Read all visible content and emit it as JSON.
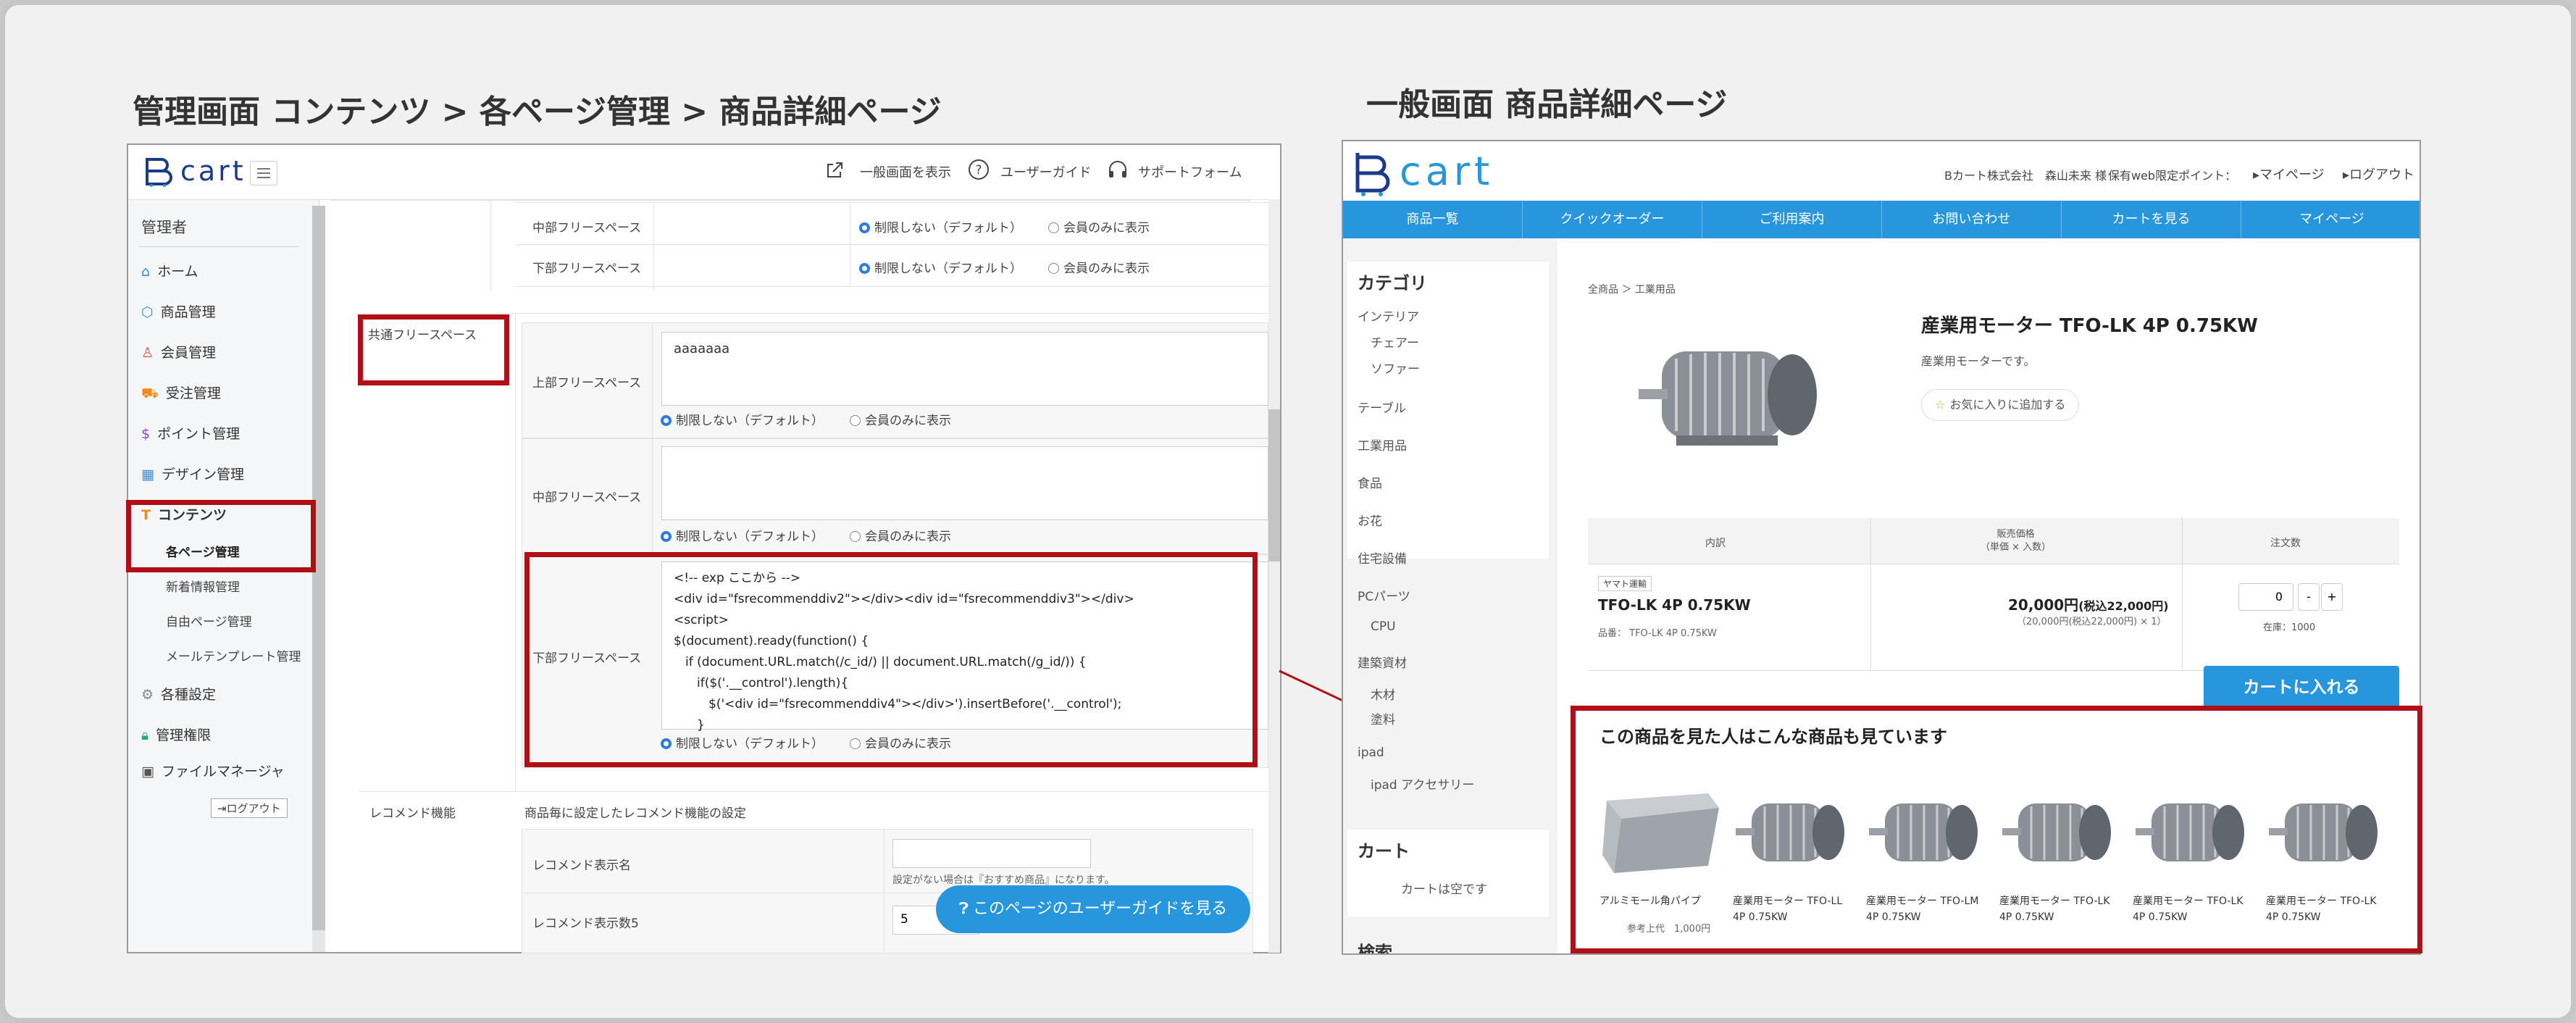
{
  "left_heading": "管理画面 コンテンツ > 各ページ管理 > 商品詳細ページ",
  "right_heading": "一般画面 商品詳細ページ",
  "admin": {
    "logo": "cart",
    "top_links": [
      "一般画面を表示",
      "ユーザーガイド",
      "サポートフォーム"
    ],
    "sidebar_title": "管理者",
    "sidebar_items": [
      "ホーム",
      "商品管理",
      "会員管理",
      "受注管理",
      "ポイント管理",
      "デザイン管理",
      "コンテンツ"
    ],
    "sidebar_subitems": [
      "各ページ管理",
      "新着情報管理",
      "自由ページ管理",
      "メールテンプレート管理"
    ],
    "sidebar_items2": [
      "各種設定",
      "管理権限",
      "ファイルマネージャ"
    ],
    "logout": "ログアウト",
    "rows": {
      "middle_free": "中部フリースペース",
      "bottom_free": "下部フリースペース",
      "common_free": "共通フリースペース",
      "top_free": "上部フリースペース",
      "recommend": "レコメンド機能",
      "recommend_desc": "商品毎に設定したレコメンド機能の設定",
      "recommend_name": "レコメンド表示名",
      "recommend_count": "レコメンド表示数5",
      "recommend_hint": "設定がない場合は『おすすめ商品』になります。",
      "recommend_count_value": "5"
    },
    "radio_unlimited": "制限しない（デフォルト）",
    "radio_members": "会員のみに表示",
    "top_textarea": "aaaaaaa",
    "code_lines": [
      "<!-- exp ここから -->",
      "<div id=\"fsrecommenddiv2\"></div><div id=\"fsrecommenddiv3\"></div>",
      "<script>",
      "$(document).ready(function() {",
      "  if (document.URL.match(/c_id/) || document.URL.match(/g_id/)) {",
      "    if($('.__control').length){",
      "      $('<div id=\"fsrecommenddiv4\"></div>').insertBefore('.__control');",
      "    }"
    ],
    "guide_button": "このページのユーザーガイドを見る"
  },
  "public": {
    "logo": "cart",
    "header_user": "Bカート株式会社　森山未来 様",
    "header_points": "保有web限定ポイント：",
    "header_mypage": "マイページ",
    "header_logout": "ログアウト",
    "nav": [
      "商品一覧",
      "クイックオーダー",
      "ご利用案内",
      "お問い合わせ",
      "カートを見る",
      "マイページ"
    ],
    "category_title": "カテゴリ",
    "categories": [
      "インテリア",
      "チェアー",
      "ソファー",
      "テーブル",
      "工業用品",
      "食品",
      "お花",
      "住宅設備",
      "PCパーツ",
      "CPU",
      "建築資材",
      "木材",
      "塗料",
      "ipad",
      "ipad アクセサリー"
    ],
    "cart_title": "カート",
    "cart_empty": "カートは空です",
    "search_title": "検索",
    "breadcrumb": "全商品 ＞ 工業用品",
    "product_title": "産業用モーター TFO-LK 4P 0.75KW",
    "product_desc": "産業用モーターです。",
    "favorite": "お気に入りに追加する",
    "table_headers": [
      "内訳",
      "販売価格\n（単価 × 入数）",
      "注文数"
    ],
    "badge": "ヤマト運輸",
    "item_name": "TFO-LK 4P 0.75KW",
    "item_code": "品番：  TFO-LK 4P 0.75KW",
    "price_main": "20,000円",
    "price_tax": "(税込22,000円)",
    "price_sub": "（20,000円(税込22,000円) × 1）",
    "qty": "0",
    "stock": "在庫：1000",
    "add_cart": "カートに入れる",
    "recommend_heading": "この商品を見た人はこんな商品も見ています",
    "products": [
      {
        "name": "アルミモール角パイプ",
        "price": "参考上代　1,000円"
      },
      {
        "name": "産業用モーター TFO-LL 4P 0.75KW",
        "price": ""
      },
      {
        "name": "産業用モーター TFO-LM 4P 0.75KW",
        "price": ""
      },
      {
        "name": "産業用モーター TFO-LK 4P 0.75KW",
        "price": ""
      },
      {
        "name": "産業用モーター TFO-LK 4P 0.75KW",
        "price": ""
      },
      {
        "name": "産業用モーター TFO-LK 4P 0.75KW",
        "price": ""
      }
    ]
  },
  "colors": {
    "accent_red": "#b01015",
    "public_blue": "#2896dc",
    "admin_logo": "#1b3a8c"
  }
}
